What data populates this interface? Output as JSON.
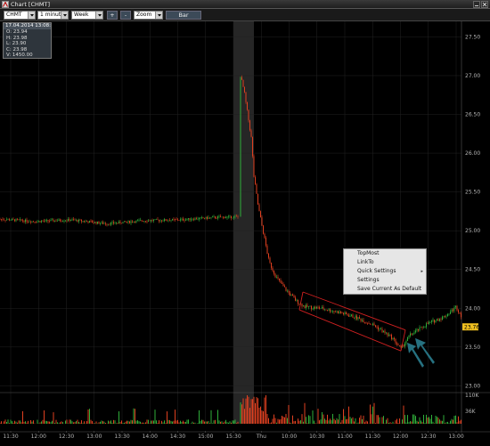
{
  "window": {
    "title": "Chart [CHMT]"
  },
  "toolbar": {
    "symbol": "CHMT",
    "interval": "1 minute",
    "range": "Week",
    "plus_label": "+",
    "minus_label": "-",
    "zoom": "Zoom",
    "bar_label": "Bar"
  },
  "infobox": {
    "header": "17.04.2014 13:08:00",
    "open": "O: 23.94",
    "high": "H: 23.98",
    "low": "L: 23.90",
    "close": "C: 23.98",
    "volume": "V: 1450.00"
  },
  "context_menu": {
    "items": [
      "TopMost",
      "LinkTo",
      "Quick Settings",
      "Settings",
      "Save Current As Default"
    ],
    "submenu_indicator": "▸"
  },
  "chart_data": {
    "type": "candlestick",
    "symbol": "CHMT",
    "price_ticks": [
      "27.50",
      "27.00",
      "26.50",
      "26.00",
      "25.50",
      "25.00",
      "24.50",
      "24.00",
      "23.50",
      "23.00"
    ],
    "current_price_label": "23.76",
    "volume_ticks": [
      "110K",
      "36K"
    ],
    "time_ticks": [
      "11:30",
      "12:00",
      "12:30",
      "13:00",
      "13:30",
      "14:00",
      "14:30",
      "15:00",
      "15:30",
      "Thu",
      "10:00",
      "10:30",
      "11:00",
      "11:30",
      "12:00",
      "12:30",
      "13:00"
    ],
    "ylim": [
      22.97,
      27.7
    ],
    "prev_session_level": 25.15,
    "price_path": [
      {
        "t": 0,
        "p": 25.15
      },
      {
        "t": 40,
        "p": 25.12
      },
      {
        "t": 80,
        "p": 25.14
      },
      {
        "t": 120,
        "p": 25.09
      },
      {
        "t": 160,
        "p": 25.13
      },
      {
        "t": 200,
        "p": 25.14
      },
      {
        "t": 240,
        "p": 25.17
      },
      {
        "t": 268,
        "p": 25.18
      },
      {
        "t": 270,
        "p": 27.0
      },
      {
        "t": 274,
        "p": 26.8
      },
      {
        "t": 278,
        "p": 26.5
      },
      {
        "t": 282,
        "p": 26.2
      },
      {
        "t": 285,
        "p": 25.7
      },
      {
        "t": 290,
        "p": 25.3
      },
      {
        "t": 296,
        "p": 24.95
      },
      {
        "t": 302,
        "p": 24.6
      },
      {
        "t": 310,
        "p": 24.4
      },
      {
        "t": 320,
        "p": 24.25
      },
      {
        "t": 332,
        "p": 24.1
      },
      {
        "t": 342,
        "p": 24.02
      },
      {
        "t": 360,
        "p": 24.0
      },
      {
        "t": 380,
        "p": 23.95
      },
      {
        "t": 400,
        "p": 23.88
      },
      {
        "t": 420,
        "p": 23.78
      },
      {
        "t": 440,
        "p": 23.62
      },
      {
        "t": 450,
        "p": 23.48
      },
      {
        "t": 460,
        "p": 23.65
      },
      {
        "t": 480,
        "p": 23.8
      },
      {
        "t": 500,
        "p": 23.9
      },
      {
        "t": 512,
        "p": 24.02
      },
      {
        "t": 518,
        "p": 23.9
      }
    ],
    "trend_channel": {
      "upper": [
        {
          "t": 340,
          "p": 24.21
        },
        {
          "t": 455,
          "p": 23.72
        }
      ],
      "lower": [
        {
          "t": 336,
          "p": 23.98
        },
        {
          "t": 450,
          "p": 23.45
        }
      ]
    },
    "session_break": {
      "t_start": 262,
      "t_end": 285
    },
    "colors": {
      "up": "#2fae3a",
      "down": "#e04020",
      "trend": "#d02020",
      "arrow": "#2a7d8e",
      "grid": "#222222",
      "axis_text": "#b5b5b5",
      "price_badge": "#f0c020"
    }
  }
}
